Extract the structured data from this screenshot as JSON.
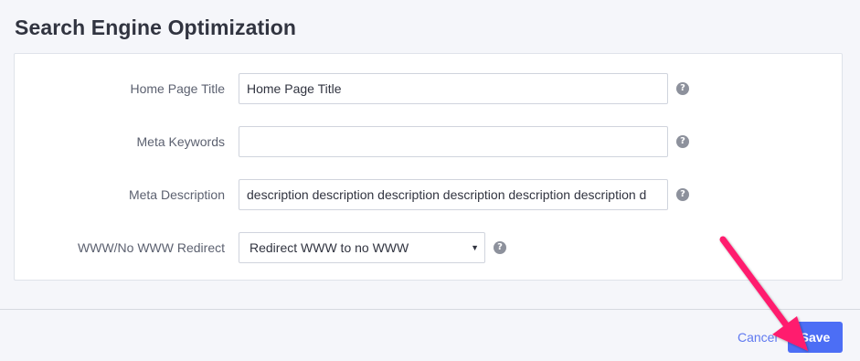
{
  "page": {
    "title": "Search Engine Optimization"
  },
  "form": {
    "home_page_title": {
      "label": "Home Page Title",
      "value": "Home Page Title",
      "help": "?"
    },
    "meta_keywords": {
      "label": "Meta Keywords",
      "value": "",
      "help": "?"
    },
    "meta_description": {
      "label": "Meta Description",
      "value": "description description description description description description d",
      "help": "?"
    },
    "www_redirect": {
      "label": "WWW/No WWW Redirect",
      "selected": "Redirect WWW to no WWW",
      "caret": "▼",
      "help": "?"
    }
  },
  "footer": {
    "cancel_label": "Cancel",
    "save_label": "Save"
  },
  "colors": {
    "accent": "#4c6ef5",
    "link": "#5f79f0",
    "annotation_arrow": "#ff1f6e"
  },
  "icons": {
    "help": "question-circle-icon",
    "dropdown": "chevron-down-icon",
    "annotation": "arrow-annotation-icon"
  }
}
